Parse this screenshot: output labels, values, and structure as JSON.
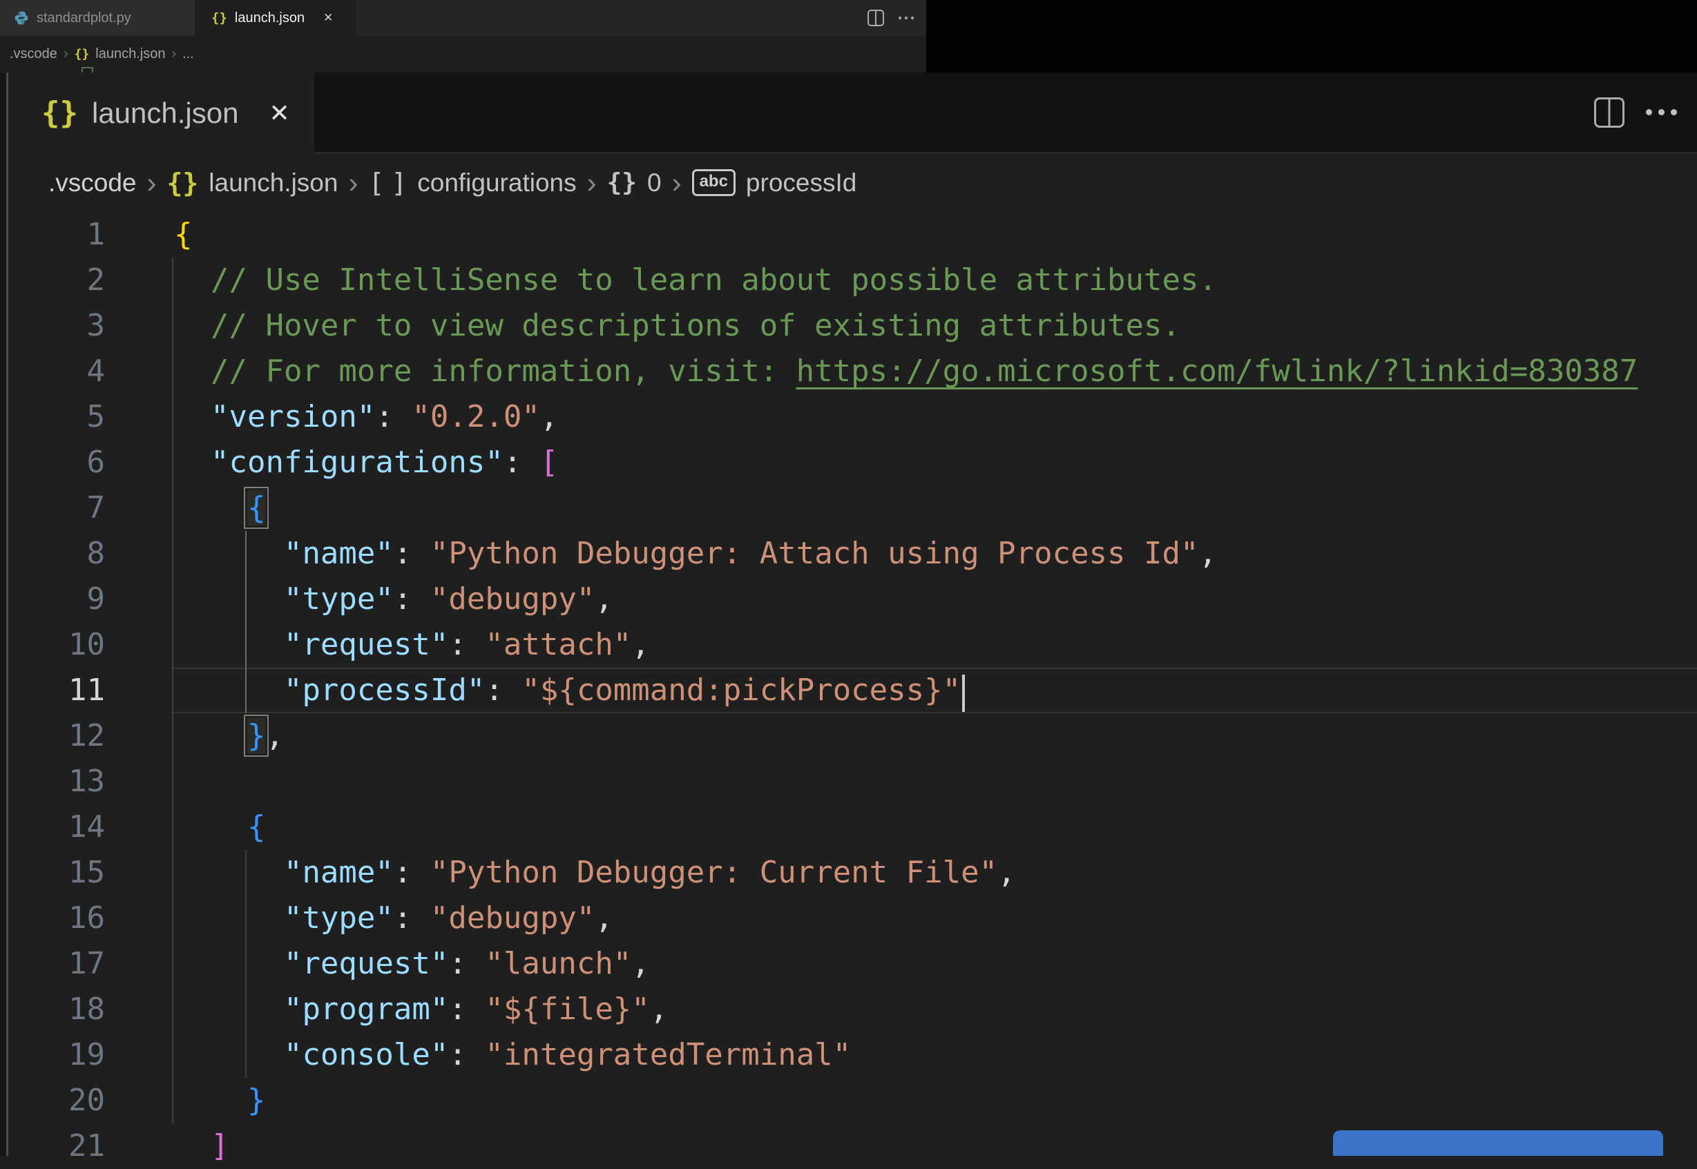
{
  "background_window": {
    "tab_bar": {
      "tabs": [
        {
          "label": "standardplot.py",
          "icon": "python-icon",
          "active": false
        },
        {
          "label": "launch.json",
          "icon": "json-braces-icon",
          "icon_glyph": "{}",
          "active": true,
          "close_glyph": "✕"
        }
      ]
    },
    "breadcrumb": {
      "separator": "›",
      "folder": ".vscode",
      "file": "launch.json",
      "file_icon_glyph": "{}",
      "collapsed": "..."
    }
  },
  "magnified_window": {
    "tab": {
      "label": "launch.json",
      "icon_glyph": "{}",
      "close_glyph": "✕"
    },
    "breadcrumb": {
      "separator": "›",
      "items": [
        {
          "label": ".vscode"
        },
        {
          "label": "launch.json",
          "icon": "json-braces-icon",
          "icon_glyph": "{}"
        },
        {
          "label": "configurations",
          "icon": "array-brackets-icon",
          "icon_open": "[",
          "icon_close": "]"
        },
        {
          "label": "0",
          "icon": "object-braces-icon",
          "icon_glyph": "{}"
        },
        {
          "label": "processId",
          "icon": "abc-symbol-icon",
          "icon_glyph": "abc"
        }
      ]
    },
    "editor": {
      "language": "json",
      "current_line": 11,
      "indent_guides": [
        {
          "col": 0,
          "from_line": 2,
          "to_line": 20,
          "active": false
        },
        {
          "col": 4,
          "from_line": 8,
          "to_line": 11,
          "active": true
        },
        {
          "col": 4,
          "from_line": 15,
          "to_line": 19,
          "active": false
        }
      ],
      "lines": [
        {
          "n": 1,
          "tokens": [
            [
              "{",
              "bgold"
            ]
          ]
        },
        {
          "n": 2,
          "tokens": [
            [
              "  ",
              "pln"
            ],
            [
              "// Use IntelliSense to learn about possible attributes.",
              "cmt"
            ]
          ]
        },
        {
          "n": 3,
          "tokens": [
            [
              "  ",
              "pln"
            ],
            [
              "// Hover to view descriptions of existing attributes.",
              "cmt"
            ]
          ]
        },
        {
          "n": 4,
          "tokens": [
            [
              "  ",
              "pln"
            ],
            [
              "// For more information, visit: ",
              "cmt"
            ],
            [
              "https://go.microsoft.com/fwlink/?linkid=830387",
              "lnk"
            ]
          ]
        },
        {
          "n": 5,
          "tokens": [
            [
              "  ",
              "pln"
            ],
            [
              "\"version\"",
              "key"
            ],
            [
              ":",
              "pun"
            ],
            [
              " ",
              "pln"
            ],
            [
              "\"0.2.0\"",
              "str"
            ],
            [
              ",",
              "pun"
            ]
          ]
        },
        {
          "n": 6,
          "tokens": [
            [
              "  ",
              "pln"
            ],
            [
              "\"configurations\"",
              "key"
            ],
            [
              ":",
              "pun"
            ],
            [
              " ",
              "pln"
            ],
            [
              "[",
              "bpink"
            ]
          ]
        },
        {
          "n": 7,
          "tokens": [
            [
              "    ",
              "pln"
            ],
            [
              "{",
              "bblue boxed"
            ]
          ]
        },
        {
          "n": 8,
          "tokens": [
            [
              "      ",
              "pln"
            ],
            [
              "\"name\"",
              "key"
            ],
            [
              ":",
              "pun"
            ],
            [
              " ",
              "pln"
            ],
            [
              "\"Python Debugger: Attach using Process Id\"",
              "str"
            ],
            [
              ",",
              "pun"
            ]
          ]
        },
        {
          "n": 9,
          "tokens": [
            [
              "      ",
              "pln"
            ],
            [
              "\"type\"",
              "key"
            ],
            [
              ":",
              "pun"
            ],
            [
              " ",
              "pln"
            ],
            [
              "\"debugpy\"",
              "str"
            ],
            [
              ",",
              "pun"
            ]
          ]
        },
        {
          "n": 10,
          "tokens": [
            [
              "      ",
              "pln"
            ],
            [
              "\"request\"",
              "key"
            ],
            [
              ":",
              "pun"
            ],
            [
              " ",
              "pln"
            ],
            [
              "\"attach\"",
              "str"
            ],
            [
              ",",
              "pun"
            ]
          ]
        },
        {
          "n": 11,
          "tokens": [
            [
              "      ",
              "pln"
            ],
            [
              "\"processId\"",
              "key"
            ],
            [
              ":",
              "pun"
            ],
            [
              " ",
              "pln"
            ],
            [
              "\"${command:pickProcess}\"",
              "str"
            ],
            [
              "",
              "cursor"
            ]
          ]
        },
        {
          "n": 12,
          "tokens": [
            [
              "    ",
              "pln"
            ],
            [
              "}",
              "bblue boxed"
            ],
            [
              ",",
              "pun"
            ]
          ]
        },
        {
          "n": 13,
          "tokens": []
        },
        {
          "n": 14,
          "tokens": [
            [
              "    ",
              "pln"
            ],
            [
              "{",
              "bblue"
            ]
          ]
        },
        {
          "n": 15,
          "tokens": [
            [
              "      ",
              "pln"
            ],
            [
              "\"name\"",
              "key"
            ],
            [
              ":",
              "pun"
            ],
            [
              " ",
              "pln"
            ],
            [
              "\"Python Debugger: Current File\"",
              "str"
            ],
            [
              ",",
              "pun"
            ]
          ]
        },
        {
          "n": 16,
          "tokens": [
            [
              "      ",
              "pln"
            ],
            [
              "\"type\"",
              "key"
            ],
            [
              ":",
              "pun"
            ],
            [
              " ",
              "pln"
            ],
            [
              "\"debugpy\"",
              "str"
            ],
            [
              ",",
              "pun"
            ]
          ]
        },
        {
          "n": 17,
          "tokens": [
            [
              "      ",
              "pln"
            ],
            [
              "\"request\"",
              "key"
            ],
            [
              ":",
              "pun"
            ],
            [
              " ",
              "pln"
            ],
            [
              "\"launch\"",
              "str"
            ],
            [
              ",",
              "pun"
            ]
          ]
        },
        {
          "n": 18,
          "tokens": [
            [
              "      ",
              "pln"
            ],
            [
              "\"program\"",
              "key"
            ],
            [
              ":",
              "pun"
            ],
            [
              " ",
              "pln"
            ],
            [
              "\"${file}\"",
              "str"
            ],
            [
              ",",
              "pun"
            ]
          ]
        },
        {
          "n": 19,
          "tokens": [
            [
              "      ",
              "pln"
            ],
            [
              "\"console\"",
              "key"
            ],
            [
              ":",
              "pun"
            ],
            [
              " ",
              "pln"
            ],
            [
              "\"integratedTerminal\"",
              "str"
            ]
          ]
        },
        {
          "n": 20,
          "tokens": [
            [
              "    ",
              "pln"
            ],
            [
              "}",
              "bblue"
            ]
          ]
        },
        {
          "n": 21,
          "tokens": [
            [
              "  ",
              "pln"
            ],
            [
              "]",
              "bpink"
            ]
          ]
        }
      ]
    },
    "add_configuration_button": {
      "color": "#3c72c8"
    }
  },
  "colors": {
    "editor_bg": "#1f1f1f",
    "tabbar_bg": "#252526",
    "tab_inactive_bg": "#2d2d2d",
    "tab_active_bg": "#1e1e1e",
    "empty_band_bg": "#121212",
    "black_area": "#030303",
    "comment_green": "#6a9955",
    "key_blue": "#9cdcfe",
    "string_orange": "#ce9178",
    "bracket_gold": "#ffd700",
    "bracket_blue": "#3794ff",
    "bracket_pink": "#da70d6",
    "line_number": "#6e7681",
    "line_number_active": "#d7d7d7",
    "json_icon_yellow": "#cbcb41",
    "python_icon_blue": "#519aba",
    "button_blue": "#3c72c8"
  }
}
